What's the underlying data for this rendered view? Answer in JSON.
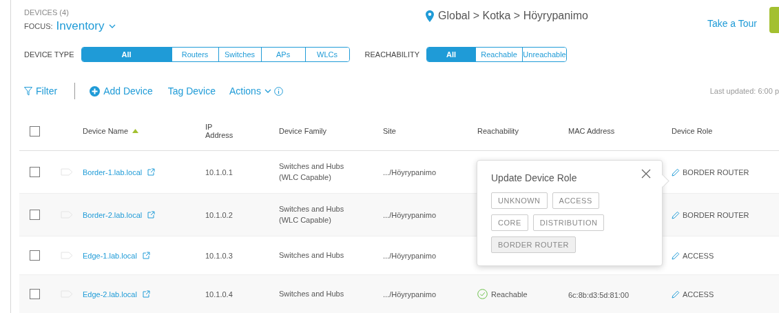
{
  "header": {
    "devices_count": "DEVICES (4)",
    "focus_label": "FOCUS:",
    "focus_value": "Inventory",
    "breadcrumb": "Global > Kotka > Höyrypanimo",
    "tour_link": "Take a Tour"
  },
  "filters": [
    {
      "label": "DEVICE TYPE",
      "options": [
        {
          "label": "All",
          "selected": true
        },
        {
          "label": "Routers",
          "selected": false
        },
        {
          "label": "Switches",
          "selected": false
        },
        {
          "label": "APs",
          "selected": false
        },
        {
          "label": "WLCs",
          "selected": false
        }
      ]
    },
    {
      "label": "REACHABILITY",
      "options": [
        {
          "label": "All",
          "selected": true
        },
        {
          "label": "Reachable",
          "selected": false
        },
        {
          "label": "Unreachable",
          "selected": false
        }
      ]
    }
  ],
  "toolbar": {
    "filter": "Filter",
    "add_device": "Add Device",
    "tag_device": "Tag Device",
    "actions": "Actions",
    "last_updated": "Last updated: 6:00 p"
  },
  "table": {
    "select_all_checked": false,
    "columns": [
      {
        "label": "Device Name",
        "sorted": true
      },
      {
        "label": "IP Address",
        "sorted": false
      },
      {
        "label": "Device Family",
        "sorted": false
      },
      {
        "label": "Site",
        "sorted": false
      },
      {
        "label": "Reachability",
        "sorted": false
      },
      {
        "label": "MAC Address",
        "sorted": false
      },
      {
        "label": "Device Role",
        "sorted": false
      }
    ],
    "rows": [
      {
        "checked": false,
        "name": "Border-1.lab.local",
        "ip": "10.1.0.1",
        "family": "Switches and Hubs (WLC Capable)",
        "site": ".../Höyrypanimo",
        "role": "BORDER ROUTER"
      },
      {
        "checked": false,
        "name": "Border-2.lab.local",
        "ip": "10.1.0.2",
        "family": "Switches and Hubs (WLC Capable)",
        "site": ".../Höyrypanimo",
        "role": "BORDER ROUTER"
      },
      {
        "checked": false,
        "name": "Edge-1.lab.local",
        "ip": "10.1.0.3",
        "family": "Switches and Hubs",
        "site": ".../Höyrypanimo",
        "role": "ACCESS"
      },
      {
        "checked": false,
        "name": "Edge-2.lab.local",
        "ip": "10.1.0.4",
        "family": "Switches and Hubs",
        "site": ".../Höyrypanimo",
        "reachability": "Reachable",
        "mac": "6c:8b:d3:5d:81:00",
        "role": "ACCESS"
      }
    ]
  },
  "popover": {
    "title": "Update Device Role",
    "options": [
      {
        "label": "UNKNOWN",
        "selected": false
      },
      {
        "label": "ACCESS",
        "selected": false
      },
      {
        "label": "CORE",
        "selected": false
      },
      {
        "label": "DISTRIBUTION",
        "selected": false
      },
      {
        "label": "BORDER ROUTER",
        "selected": true
      }
    ]
  }
}
